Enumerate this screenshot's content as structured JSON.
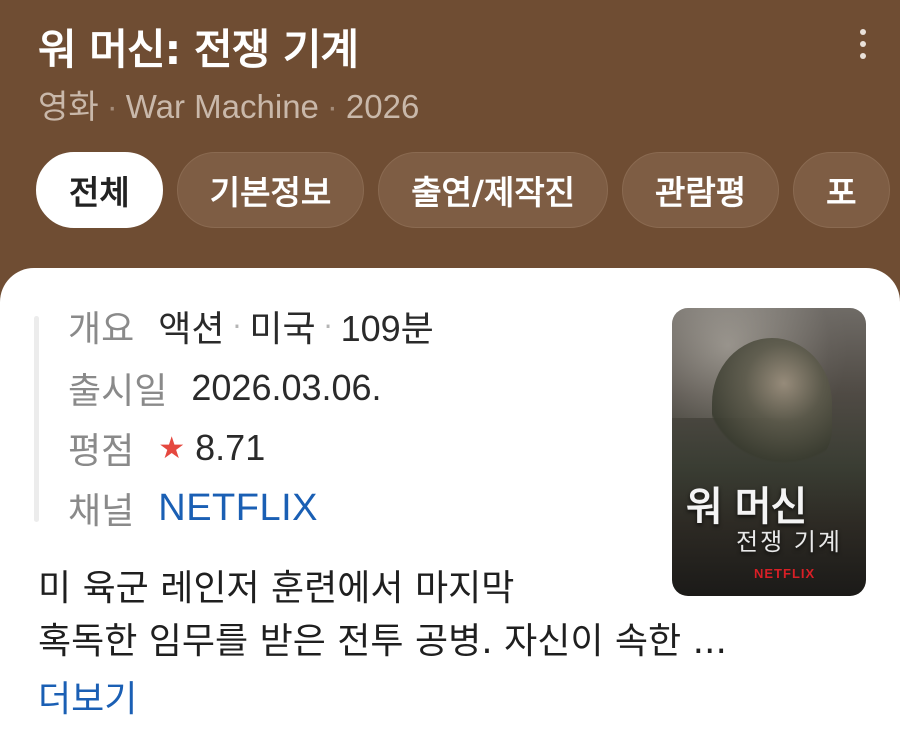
{
  "header": {
    "title": "워 머신: 전쟁 기계",
    "subtitle_parts": [
      "영화",
      "War Machine",
      "2026"
    ],
    "tabs": [
      {
        "label": "전체",
        "active": true
      },
      {
        "label": "기본정보",
        "active": false
      },
      {
        "label": "출연/제작진",
        "active": false
      },
      {
        "label": "관람평",
        "active": false
      },
      {
        "label": "포",
        "active": false
      }
    ]
  },
  "info": {
    "overview": {
      "label": "개요",
      "genre": "액션",
      "country": "미국",
      "runtime": "109분"
    },
    "release": {
      "label": "출시일",
      "value": "2026.03.06."
    },
    "rating": {
      "label": "평점",
      "star": "★",
      "value": "8.71"
    },
    "channel": {
      "label": "채널",
      "value": "NETFLIX"
    }
  },
  "poster": {
    "title_line1": "워 머신",
    "title_line2": "전쟁 기계",
    "brand": "NETFLIX"
  },
  "synopsis": {
    "line1": "미 육군 레인저 훈련에서 마지막",
    "line2": "혹독한 임무를 받은 전투 공병. 자신이 속한 ...",
    "read_more": "더보기"
  },
  "colors": {
    "header_bg": "#6f4d33",
    "accent_link": "#1a5fb4",
    "star": "#e5483f"
  }
}
